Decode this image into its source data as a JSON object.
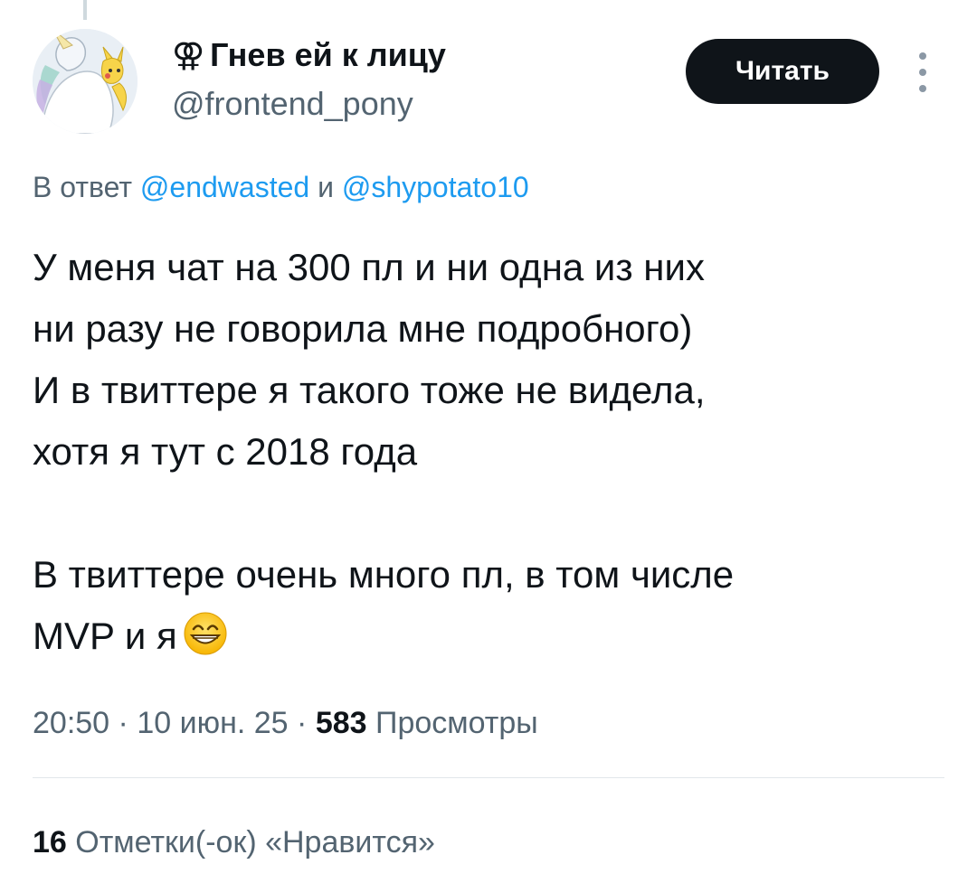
{
  "author": {
    "display_name_glyph": "⚢",
    "display_name": "Гнев ей к лицу",
    "handle": "@frontend_pony"
  },
  "follow_button_label": "Читать",
  "reply_to": {
    "prefix": "В ответ",
    "user1": "@endwasted",
    "conjunction": "и",
    "user2": "@shypotato10"
  },
  "tweet": {
    "paragraph1": "У меня чат на 300 пл и ни одна из них\nни разу не говорила мне подробного)\nИ в твиттере я такого тоже не видела,\nхотя я тут с 2018 года",
    "paragraph2": "В твиттере очень много пл, в том числе\nMVP  и я",
    "emoji": "grinning-face-with-smiling-eyes"
  },
  "meta": {
    "time": "20:50",
    "separator": "·",
    "date": "10 июн. 25",
    "views_count": "583",
    "views_label": "Просмотры"
  },
  "likes": {
    "count": "16",
    "label": "Отметки(-ок) «Нравится»"
  },
  "colors": {
    "text": "#0f1419",
    "secondary": "#536471",
    "link": "#1d9bf0",
    "button_bg": "#0f1419"
  }
}
